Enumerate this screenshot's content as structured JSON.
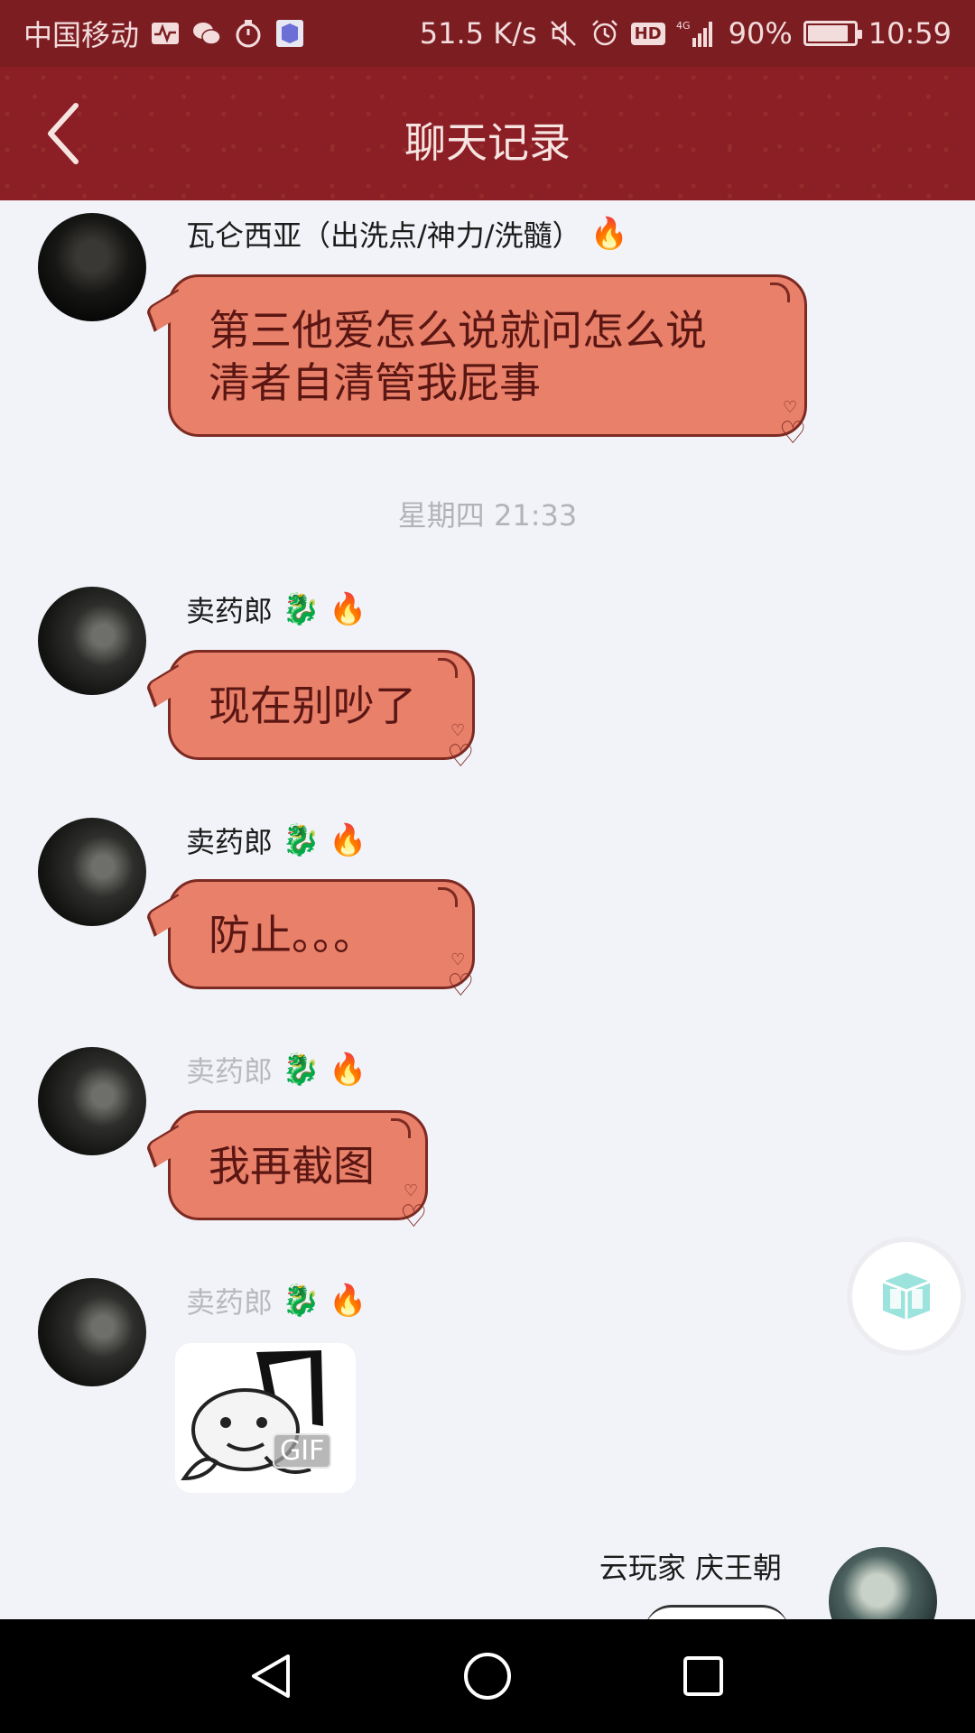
{
  "status_bar": {
    "carrier": "中国移动",
    "speed": "51.5 K/s",
    "hd": "HD",
    "network": "4G",
    "battery": "90%",
    "battery_level": 0.9,
    "time": "10:59",
    "icons": [
      "activity-icon",
      "wechat-icon",
      "timer-icon",
      "app-cube-icon",
      "mute-icon",
      "alarm-icon",
      "hd-icon",
      "signal-icon",
      "battery-icon"
    ]
  },
  "header": {
    "title": "聊天记录",
    "back_icon": "chevron-left-icon"
  },
  "messages": [
    {
      "sender": "瓦仑西亚（出洗点/神力/洗髓）",
      "badges": [
        "🔥"
      ],
      "text_lines": [
        "第三他爱怎么说就问怎么说",
        "清者自清管我屁事"
      ]
    },
    {
      "timestamp": "星期四 21:33"
    },
    {
      "sender": "卖药郎",
      "badges": [
        "🐉",
        "🔥"
      ],
      "text": "现在别吵了"
    },
    {
      "sender": "卖药郎",
      "badges": [
        "🐉",
        "🔥"
      ],
      "text": "防止。。。"
    },
    {
      "sender": "卖药郎",
      "badges": [
        "🐉",
        "🔥"
      ],
      "text": "我再截图"
    },
    {
      "sender": "卖药郎",
      "badges": [
        "🐉",
        "🔥"
      ],
      "sticker_label": "GIF"
    },
    {
      "sender": "云玩家  庆王朝",
      "self": true
    }
  ],
  "colors": {
    "statusbar": "#7c1d22",
    "titlebar": "#8c1f25",
    "bubble": "#e8806a",
    "bubble_border": "#7c2a22",
    "background": "#f2f3f8",
    "float_button_icon": "#7fd8d0"
  },
  "navigation": {
    "back": "nav-back-icon",
    "home": "nav-home-icon",
    "recents": "nav-recents-icon"
  }
}
